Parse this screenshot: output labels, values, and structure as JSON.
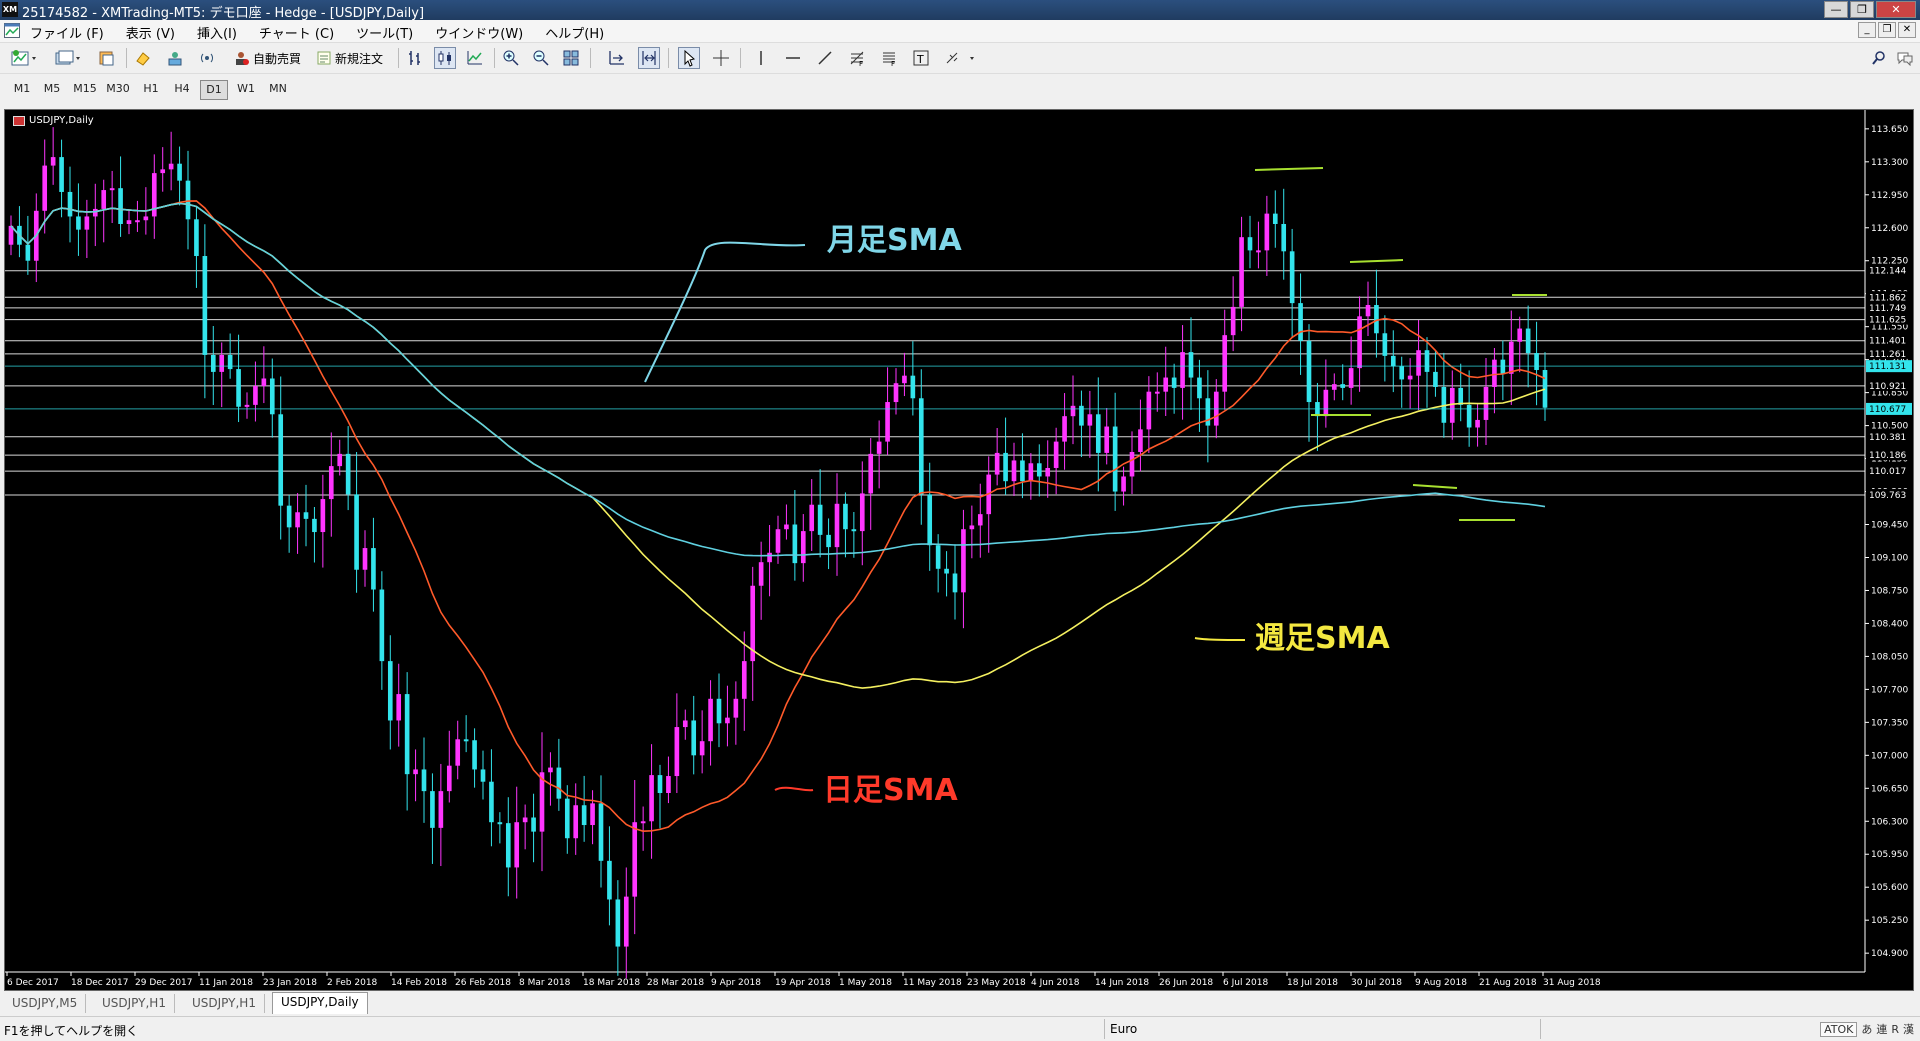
{
  "window": {
    "title": "25174582 - XMTrading-MT5: デモ口座 - Hedge - [USDJPY,Daily]",
    "logo": "XM",
    "controls": [
      "minimize-icon",
      "restore-icon",
      "close-icon"
    ]
  },
  "menu": [
    "ファイル (F)",
    "表示 (V)",
    "挿入(I)",
    "チャート (C)",
    "ツール(T)",
    "ウインドウ(W)",
    "ヘルプ(H)"
  ],
  "toolbar": {
    "auto_trade_label": "自動売買",
    "new_order_label": "新規注文"
  },
  "timeframes": [
    "M1",
    "M5",
    "M15",
    "M30",
    "H1",
    "H4",
    "D1",
    "W1",
    "MN"
  ],
  "active_timeframe": "D1",
  "chart": {
    "symbol_label": "USDJPY,Daily",
    "up_color": "#ff35ff",
    "down_color": "#33e4ec",
    "daily_sma_color": "#ff5a2a",
    "weekly_sma_color": "#f4f060",
    "monthly_sma_color": "#5fd0e0"
  },
  "chart_data": {
    "type": "candlestick",
    "symbol": "USDJPY",
    "timeframe": "Daily",
    "y_ticks": [
      "113.650",
      "113.300",
      "112.950",
      "112.600",
      "112.250",
      "111.900",
      "111.550",
      "111.200",
      "110.850",
      "110.500",
      "110.150",
      "109.800",
      "109.450",
      "109.100",
      "108.750",
      "108.400",
      "108.050",
      "107.700",
      "107.350",
      "107.000",
      "106.650",
      "106.300",
      "105.950",
      "105.600",
      "105.250",
      "104.900"
    ],
    "ylim": [
      104.7,
      113.85
    ],
    "x_ticks": [
      "6 Dec 2017",
      "18 Dec 2017",
      "29 Dec 2017",
      "11 Jan 2018",
      "23 Jan 2018",
      "2 Feb 2018",
      "14 Feb 2018",
      "26 Feb 2018",
      "8 Mar 2018",
      "18 Mar 2018",
      "28 Mar 2018",
      "9 Apr 2018",
      "19 Apr 2018",
      "1 May 2018",
      "11 May 2018",
      "23 May 2018",
      "4 Jun 2018",
      "14 Jun 2018",
      "26 Jun 2018",
      "6 Jul 2018",
      "18 Jul 2018",
      "30 Jul 2018",
      "9 Aug 2018",
      "21 Aug 2018",
      "31 Aug 2018"
    ],
    "horizontal_levels": [
      "112.144",
      "111.862",
      "111.749",
      "111.625",
      "111.401",
      "111.261",
      "110.921",
      "110.381",
      "110.186",
      "110.017",
      "109.763"
    ],
    "price_marker": {
      "value": "111.131",
      "color": "#33e4ec"
    },
    "sma_marker": {
      "value": "110.677",
      "color": "#33e4ec"
    },
    "series": [
      {
        "name": "日足SMA",
        "color": "#ff5a2a"
      },
      {
        "name": "週足SMA",
        "color": "#f4f060"
      },
      {
        "name": "月足SMA",
        "color": "#5fd0e0"
      }
    ],
    "annotations": [
      {
        "text": "月足SMA",
        "color": "#7fd6e8"
      },
      {
        "text": "週足SMA",
        "color": "#f4e840"
      },
      {
        "text": "日足SMA",
        "color": "#ff3a2a"
      }
    ],
    "closes": [
      112.62,
      112.42,
      112.25,
      112.78,
      113.26,
      113.35,
      112.98,
      112.72,
      112.58,
      112.72,
      112.8,
      113.0,
      113.02,
      112.64,
      112.68,
      112.68,
      112.72,
      113.18,
      113.22,
      113.28,
      113.1,
      112.69,
      112.3,
      111.25,
      111.07,
      111.25,
      111.1,
      110.7,
      110.72,
      110.92,
      111.0,
      110.62,
      109.65,
      109.42,
      109.58,
      109.51,
      109.37,
      109.72,
      110.07,
      110.2,
      109.77,
      108.97,
      109.2,
      108.76,
      108.0,
      107.37,
      107.65,
      106.8,
      106.85,
      106.62,
      106.23,
      106.62,
      106.89,
      107.17,
      107.16,
      106.85,
      106.72,
      106.29,
      106.28,
      105.81,
      106.29,
      106.34,
      106.19,
      106.82,
      106.87,
      106.54,
      106.12,
      106.47,
      106.26,
      106.49,
      105.88,
      105.47,
      104.97,
      105.5,
      106.29,
      106.3,
      106.79,
      106.6,
      106.78,
      107.3,
      107.37,
      107.0,
      107.15,
      107.6,
      107.34,
      107.4,
      107.6,
      108.0,
      108.8,
      109.05,
      109.15,
      109.4,
      109.45,
      109.04,
      109.38,
      109.66,
      109.34,
      109.21,
      109.67,
      109.4,
      109.38,
      109.78,
      110.2,
      110.33,
      110.75,
      110.95,
      111.03,
      110.79,
      109.77,
      109.23,
      108.98,
      108.93,
      108.73,
      109.4,
      109.44,
      109.56,
      109.98,
      110.21,
      109.91,
      110.13,
      109.91,
      110.1,
      109.96,
      110.05,
      110.33,
      110.6,
      110.71,
      110.5,
      110.62,
      110.21,
      110.49,
      109.8,
      109.96,
      110.22,
      110.46,
      110.86,
      110.86,
      111.01,
      110.9,
      111.28,
      111.01,
      110.79,
      110.5,
      110.86,
      111.46,
      111.76,
      112.5,
      112.36,
      112.36,
      112.75,
      112.64,
      112.35,
      111.8,
      111.4,
      110.75,
      110.6,
      110.88,
      110.94,
      110.9,
      111.11,
      111.66,
      111.78,
      111.48,
      111.24,
      111.13,
      110.99,
      111.03,
      111.3,
      111.07,
      110.91,
      110.53,
      110.9,
      110.72,
      110.48,
      110.56,
      110.91,
      111.2,
      111.05,
      111.39,
      111.53,
      111.27,
      111.09,
      110.69
    ]
  },
  "tabs": [
    "USDJPY,M5",
    "USDJPY,H1",
    "USDJPY,H1",
    "USDJPY,Daily"
  ],
  "active_tab": 3,
  "status": {
    "help": "F1を押してヘルプを開く",
    "profile": "Euro",
    "ime": [
      "ATOK",
      "あ",
      "連",
      "R",
      "漢"
    ]
  }
}
